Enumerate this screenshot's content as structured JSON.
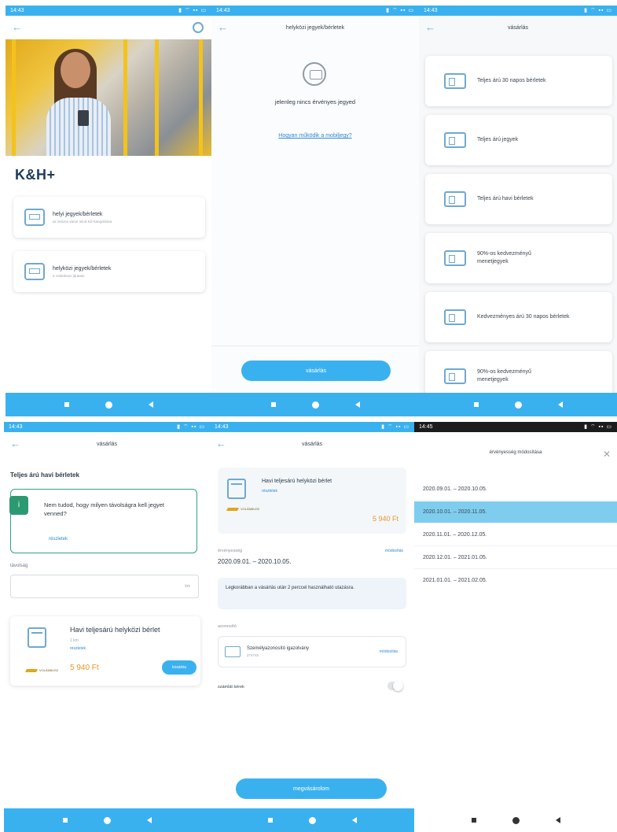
{
  "status": {
    "time": "14:43",
    "time_dark": "14:45",
    "icons": "▮ ⌔ ▪▪ ▭"
  },
  "screen1": {
    "brand": "K&H+",
    "cards": [
      {
        "title": "helyi jegyek/bérletek",
        "subtitle": "az összes város mind KD hangolódva"
      },
      {
        "title": "helyközi jegyek/bérletek",
        "subtitle": "a Volánbusz járatain"
      }
    ]
  },
  "screen2": {
    "title": "helyközi jegyek/bérletek",
    "empty_text": "jelenleg nincs érvényes jegyed",
    "link": "Hogyan működik a mobiljegy?",
    "button": "vásárlás"
  },
  "screen3": {
    "title": "vásárlás",
    "items": [
      "Teljes árú 30 napos bérletek",
      "Teljes árú jegyek",
      "Teljes árú havi bérletek",
      "90%-os kedvezményű menetjegyek",
      "Kedvezményes árú 30 napos bérletek",
      "90%-os kedvezményű menetjegyek"
    ]
  },
  "screen4": {
    "title": "vásárlás",
    "section_title": "Teljes árú havi bérletek",
    "info_text": "Nem tudod, hogy milyen távolságra kell jegyet venned?",
    "info_link": "részletek",
    "field_label": "távolság",
    "field_suffix": "km",
    "product": {
      "title": "Havi teljesárú helyközi bérlet",
      "subtitle": "1 km",
      "link": "részletek",
      "operator": "VOLÁNBUSZ",
      "price": "5 940 Ft",
      "button": "kosárba"
    }
  },
  "screen5": {
    "title": "vásárlás",
    "product_title": "Havi teljesárú helyközi bérlet",
    "product_link": "részletek",
    "operator": "VOLÁNBUSZ",
    "price": "5 940 Ft",
    "validity_label": "érvényesség",
    "validity_link": "módosítás",
    "validity_value": "2020.09.01. – 2020.10.05.",
    "notice": "Legkorábban a vásárlás után 2 perccel használható utazásra.",
    "id_label": "azonosító",
    "id_name": "Személyazonosító igazolvány",
    "id_number": "274745",
    "id_link": "módosítás",
    "invoice_label": "számlát kérek",
    "button": "megvásárolom"
  },
  "screen6": {
    "title": "érvényesség módosítása",
    "periods": [
      "2020.09.01. – 2020.10.05.",
      "2020.10.01. – 2020.11.05.",
      "2020.11.01. – 2020.12.05.",
      "2020.12.01. – 2021.01.05.",
      "2021.01.01. – 2021.02.05."
    ],
    "selected_index": 1
  }
}
